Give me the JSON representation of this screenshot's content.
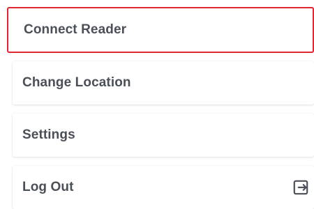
{
  "menu": {
    "items": [
      {
        "label": "Connect Reader",
        "selected": true
      },
      {
        "label": "Change Location"
      },
      {
        "label": "Settings"
      },
      {
        "label": "Log Out",
        "icon": "logout-icon"
      }
    ]
  },
  "colors": {
    "selected_border": "#e2252f",
    "text": "#4b4f57"
  }
}
